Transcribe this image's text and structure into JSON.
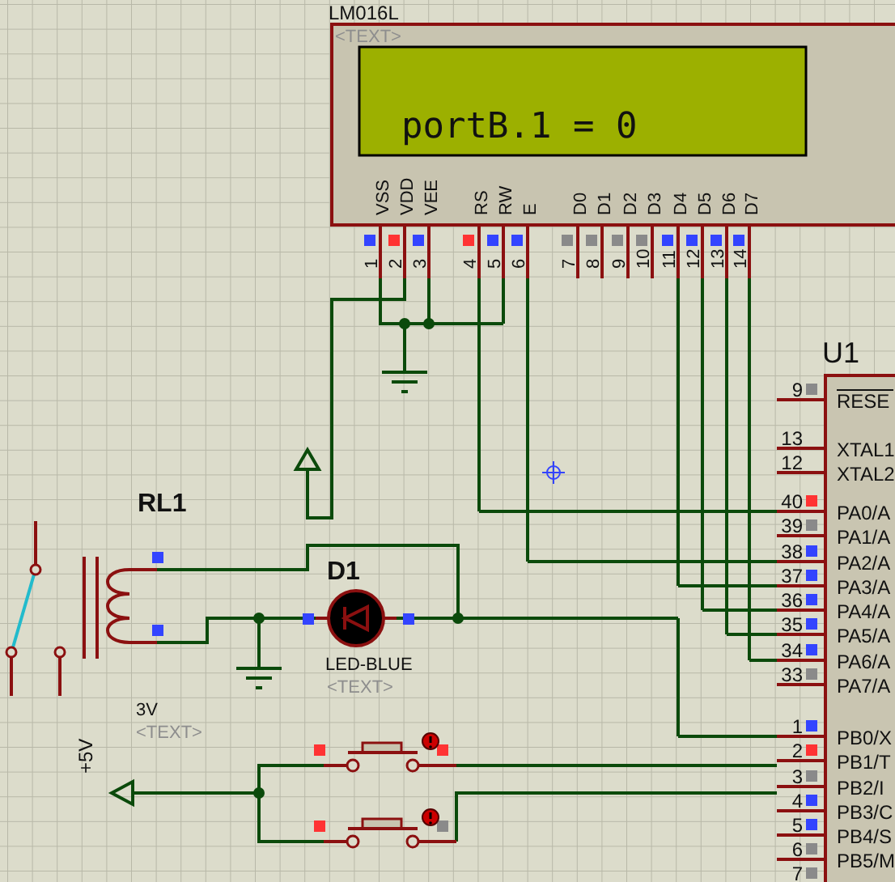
{
  "lcd": {
    "part": "LM016L",
    "tag": "<TEXT>",
    "display": "portB.1 = 0",
    "pin_groups": [
      [
        {
          "label": "VSS",
          "number": "1",
          "color": "#3344ff"
        },
        {
          "label": "VDD",
          "number": "2",
          "color": "#ff3333"
        },
        {
          "label": "VEE",
          "number": "3",
          "color": "#3344ff"
        }
      ],
      [
        {
          "label": "RS",
          "number": "4",
          "color": "#ff3333"
        },
        {
          "label": "RW",
          "number": "5",
          "color": "#3344ff"
        },
        {
          "label": "E",
          "number": "6",
          "color": "#3344ff"
        }
      ],
      [
        {
          "label": "D0",
          "number": "7",
          "color": "#8a8a8a"
        },
        {
          "label": "D1",
          "number": "8",
          "color": "#8a8a8a"
        },
        {
          "label": "D2",
          "number": "9",
          "color": "#8a8a8a"
        },
        {
          "label": "D3",
          "number": "10",
          "color": "#8a8a8a"
        },
        {
          "label": "D4",
          "number": "11",
          "color": "#3344ff"
        },
        {
          "label": "D5",
          "number": "12",
          "color": "#3344ff"
        },
        {
          "label": "D6",
          "number": "13",
          "color": "#3344ff"
        },
        {
          "label": "D7",
          "number": "14",
          "color": "#3344ff"
        }
      ]
    ]
  },
  "mcu": {
    "ref": "U1",
    "pin_groups": [
      [
        {
          "number": "9",
          "label": "RESE",
          "overline": true,
          "color": "#8a8a8a"
        }
      ],
      [
        {
          "number": "13",
          "label": "XTAL1",
          "overline": false
        },
        {
          "number": "12",
          "label": "XTAL2",
          "overline": false
        }
      ],
      [
        {
          "number": "40",
          "label": "PA0/A",
          "overline": false,
          "color": "#ff3333"
        },
        {
          "number": "39",
          "label": "PA1/A",
          "overline": false,
          "color": "#8a8a8a"
        },
        {
          "number": "38",
          "label": "PA2/A",
          "overline": false,
          "color": "#3344ff"
        },
        {
          "number": "37",
          "label": "PA3/A",
          "overline": false,
          "color": "#3344ff"
        },
        {
          "number": "36",
          "label": "PA4/A",
          "overline": false,
          "color": "#3344ff"
        },
        {
          "number": "35",
          "label": "PA5/A",
          "overline": false,
          "color": "#3344ff"
        },
        {
          "number": "34",
          "label": "PA6/A",
          "overline": false,
          "color": "#3344ff"
        },
        {
          "number": "33",
          "label": "PA7/A",
          "overline": false,
          "color": "#8a8a8a"
        }
      ],
      [
        {
          "number": "1",
          "label": "PB0/X",
          "overline": false,
          "color": "#3344ff"
        },
        {
          "number": "2",
          "label": "PB1/T",
          "overline": false,
          "color": "#ff3333"
        },
        {
          "number": "3",
          "label": "PB2/I",
          "overline": false,
          "color": "#8a8a8a"
        },
        {
          "number": "4",
          "label": "PB3/C",
          "overline": false,
          "color": "#3344ff"
        },
        {
          "number": "5",
          "label": "PB4/S",
          "overline": false,
          "color": "#3344ff"
        },
        {
          "number": "6",
          "label": "PB5/M",
          "overline": false,
          "color": "#8a8a8a"
        },
        {
          "number": "7",
          "color": "#8a8a8a"
        }
      ]
    ]
  },
  "relay": {
    "ref": "RL1",
    "value": "3V",
    "tag": "<TEXT>",
    "terminals": [
      {
        "color": "#3344ff"
      },
      {
        "color": "#3344ff"
      }
    ]
  },
  "led": {
    "ref": "D1",
    "value": "LED-BLUE",
    "tag": "<TEXT>",
    "lit": false,
    "terminals": [
      {
        "color": "#3344ff"
      },
      {
        "color": "#3344ff"
      }
    ]
  },
  "power": {
    "label": "+5V"
  },
  "buttons": [
    {
      "pressed": false,
      "terminals": [
        {
          "color": "#ff3333"
        },
        {
          "color": "#ff3333"
        }
      ]
    },
    {
      "pressed": false,
      "terminals": [
        {
          "color": "#ff3333"
        },
        {
          "color": "#8a8a8a"
        }
      ]
    }
  ]
}
